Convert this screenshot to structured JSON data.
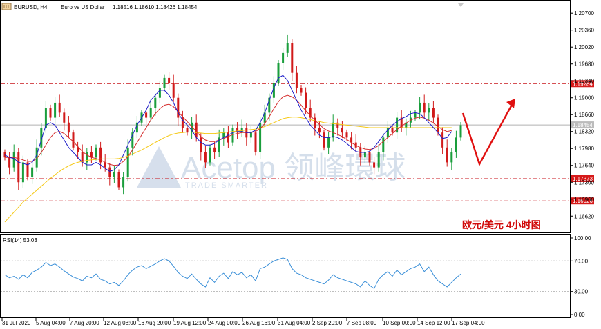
{
  "header": {
    "symbol": "EURUSD, H4:",
    "description": "Euro vs US Dollar",
    "ohlc": "1.18516 1.18610 1.18426 1.18454"
  },
  "rsi_panel": {
    "label": "RSI(14) 53.03"
  },
  "annotation": {
    "text": "欧元/美元  4小时图"
  },
  "watermark": {
    "brand": "Acetop 领峰環球",
    "tagline": "TRADE SMARTER"
  },
  "colors": {
    "bull_candle": "#1a9e3c",
    "bear_candle": "#d11a1a",
    "ma_fast": "#1c1cc8",
    "ma_mid": "#d42a2a",
    "ma_slow": "#f5c916",
    "level_lines": "#c8161c",
    "rsi_line": "#3a8fd8",
    "forecast_arrow": "#e01010",
    "price_tag": "#d61a1a",
    "current_tag": "#bcbcbc"
  },
  "chart_data": [
    {
      "type": "candlestick",
      "name": "price",
      "y_ticks": [
        "1.20700",
        "1.20360",
        "1.20020",
        "1.19680",
        "1.19340",
        "1.19000",
        "1.18660",
        "1.18320",
        "1.17980",
        "1.17640",
        "1.17300",
        "1.16960",
        "1.16620"
      ],
      "ylim": [
        1.1636,
        1.208
      ],
      "x_ticks": [
        "31 Jul 2020",
        "5 Aug 04:00",
        "7 Aug 20:00",
        "12 Aug 08:00",
        "16 Aug 20:00",
        "19 Aug 12:00",
        "24 Aug 00:00",
        "26 Aug 16:00",
        "31 Aug 04:00",
        "2 Sep 20:00",
        "7 Sep 08:00",
        "10 Sep 00:00",
        "14 Sep 12:00",
        "17 Sep 04:00"
      ],
      "horizontal_levels": [
        {
          "value": 1.19284,
          "label": "1.19284"
        },
        {
          "value": 1.17373,
          "label": "1.17373"
        },
        {
          "value": 1.16926,
          "label": "1.16926"
        }
      ],
      "current_price": {
        "value": 1.18454,
        "label": "1.18454"
      },
      "close": [
        1.178,
        1.176,
        1.179,
        1.173,
        1.177,
        1.174,
        1.176,
        1.18,
        1.184,
        1.188,
        1.186,
        1.189,
        1.187,
        1.185,
        1.183,
        1.18,
        1.179,
        1.177,
        1.179,
        1.178,
        1.18,
        1.177,
        1.176,
        1.174,
        1.175,
        1.172,
        1.174,
        1.18,
        1.183,
        1.185,
        1.187,
        1.186,
        1.188,
        1.19,
        1.192,
        1.194,
        1.193,
        1.19,
        1.186,
        1.184,
        1.183,
        1.185,
        1.182,
        1.179,
        1.177,
        1.18,
        1.179,
        1.182,
        1.183,
        1.181,
        1.184,
        1.183,
        1.184,
        1.182,
        1.183,
        1.179,
        1.185,
        1.187,
        1.19,
        1.193,
        1.197,
        1.199,
        1.201,
        1.195,
        1.192,
        1.191,
        1.188,
        1.186,
        1.184,
        1.183,
        1.18,
        1.182,
        1.185,
        1.184,
        1.183,
        1.182,
        1.181,
        1.18,
        1.178,
        1.179,
        1.177,
        1.176,
        1.179,
        1.182,
        1.184,
        1.183,
        1.186,
        1.184,
        1.185,
        1.186,
        1.187,
        1.189,
        1.187,
        1.188,
        1.186,
        1.183,
        1.18,
        1.177,
        1.179,
        1.182,
        1.1845
      ],
      "ma_fast": [
        1.1785,
        1.178,
        1.1778,
        1.177,
        1.1768,
        1.1765,
        1.177,
        1.1785,
        1.1815,
        1.1845,
        1.185,
        1.1845,
        1.183,
        1.1815,
        1.18,
        1.179,
        1.178,
        1.177,
        1.1765,
        1.1765,
        1.177,
        1.1765,
        1.1758,
        1.1752,
        1.1755,
        1.1765,
        1.1785,
        1.1805,
        1.1825,
        1.1845,
        1.186,
        1.1875,
        1.1895,
        1.1905,
        1.1915,
        1.1915,
        1.1905,
        1.189,
        1.187,
        1.1855,
        1.1845,
        1.1835,
        1.182,
        1.181,
        1.1805,
        1.1805,
        1.1808,
        1.1815,
        1.182,
        1.1825,
        1.183,
        1.1832,
        1.1832,
        1.183,
        1.183,
        1.1835,
        1.185,
        1.187,
        1.1895,
        1.192,
        1.194,
        1.1945,
        1.1935,
        1.1915,
        1.1895,
        1.1875,
        1.186,
        1.1845,
        1.1835,
        1.1825,
        1.182,
        1.182,
        1.1822,
        1.182,
        1.1815,
        1.1808,
        1.18,
        1.1792,
        1.179,
        1.179,
        1.1792,
        1.18,
        1.1812,
        1.1825,
        1.1835,
        1.1845,
        1.1852,
        1.1858,
        1.1862,
        1.1868,
        1.187,
        1.1868,
        1.186,
        1.185,
        1.184,
        1.183,
        1.1818,
        1.182,
        1.1832
      ],
      "ma_mid": [
        1.178,
        1.178,
        1.178,
        1.1778,
        1.1775,
        1.1772,
        1.1772,
        1.1778,
        1.179,
        1.1805,
        1.182,
        1.183,
        1.1832,
        1.1828,
        1.182,
        1.1812,
        1.1802,
        1.1792,
        1.1785,
        1.178,
        1.1778,
        1.1775,
        1.177,
        1.1766,
        1.1764,
        1.1765,
        1.1772,
        1.1782,
        1.1795,
        1.181,
        1.1825,
        1.184,
        1.1855,
        1.1868,
        1.1878,
        1.1885,
        1.1887,
        1.1882,
        1.1872,
        1.1862,
        1.1852,
        1.1842,
        1.1832,
        1.1822,
        1.1815,
        1.1812,
        1.1812,
        1.1815,
        1.1818,
        1.1822,
        1.1826,
        1.1828,
        1.183,
        1.183,
        1.183,
        1.1832,
        1.1838,
        1.1848,
        1.1862,
        1.1878,
        1.1892,
        1.1902,
        1.1905,
        1.1902,
        1.1895,
        1.1885,
        1.1874,
        1.1864,
        1.1855,
        1.1846,
        1.1838,
        1.1833,
        1.183,
        1.1826,
        1.1822,
        1.1816,
        1.181,
        1.1804,
        1.18,
        1.1797,
        1.1796,
        1.1798,
        1.1804,
        1.1812,
        1.182,
        1.1828,
        1.1836,
        1.1843,
        1.1849,
        1.1855,
        1.1859,
        1.1861,
        1.1859,
        1.1855,
        1.1849,
        1.1842,
        1.1836,
        1.1832,
        1.1834
      ],
      "ma_slow": [
        1.165,
        1.166,
        1.167,
        1.168,
        1.169,
        1.1698,
        1.1706,
        1.1714,
        1.1722,
        1.173,
        1.1738,
        1.1745,
        1.1752,
        1.1758,
        1.1763,
        1.1767,
        1.177,
        1.1772,
        1.1774,
        1.1775,
        1.1776,
        1.1777,
        1.1777,
        1.1777,
        1.1777,
        1.1778,
        1.178,
        1.1783,
        1.1787,
        1.1791,
        1.1795,
        1.18,
        1.1805,
        1.181,
        1.1815,
        1.182,
        1.1824,
        1.1827,
        1.1829,
        1.183,
        1.1831,
        1.1831,
        1.183,
        1.1829,
        1.1828,
        1.1828,
        1.1828,
        1.1829,
        1.183,
        1.1831,
        1.1832,
        1.1833,
        1.1834,
        1.1835,
        1.1836,
        1.1837,
        1.1839,
        1.1842,
        1.1846,
        1.185,
        1.1854,
        1.1858,
        1.186,
        1.1861,
        1.1861,
        1.186,
        1.1858,
        1.1856,
        1.1854,
        1.1852,
        1.185,
        1.1849,
        1.1848,
        1.1847,
        1.1846,
        1.1845,
        1.1844,
        1.1843,
        1.1842,
        1.1841,
        1.184,
        1.184,
        1.184,
        1.184,
        1.184,
        1.184,
        1.184,
        1.184,
        1.184,
        1.184,
        1.184,
        1.184,
        1.184,
        1.184,
        1.184,
        1.184,
        1.184,
        1.184,
        1.184
      ]
    },
    {
      "type": "line",
      "name": "RSI(14)",
      "y_ticks": [
        "100.00",
        "70.00",
        "30.00",
        "0.00"
      ],
      "ylim": [
        0,
        100
      ],
      "guide_levels": [
        70,
        30
      ],
      "values": [
        52,
        48,
        50,
        46,
        52,
        48,
        55,
        58,
        62,
        68,
        64,
        66,
        62,
        57,
        53,
        49,
        47,
        44,
        50,
        48,
        53,
        46,
        44,
        40,
        42,
        38,
        44,
        52,
        58,
        62,
        64,
        60,
        63,
        66,
        70,
        73,
        70,
        63,
        55,
        50,
        47,
        53,
        46,
        40,
        36,
        48,
        42,
        50,
        54,
        47,
        56,
        52,
        55,
        48,
        52,
        44,
        60,
        62,
        66,
        70,
        72,
        74,
        72,
        60,
        54,
        52,
        48,
        46,
        44,
        42,
        40,
        45,
        52,
        48,
        46,
        44,
        42,
        40,
        36,
        44,
        38,
        34,
        46,
        52,
        56,
        50,
        58,
        52,
        56,
        60,
        62,
        66,
        56,
        62,
        52,
        44,
        40,
        36,
        42,
        48,
        53
      ]
    }
  ]
}
